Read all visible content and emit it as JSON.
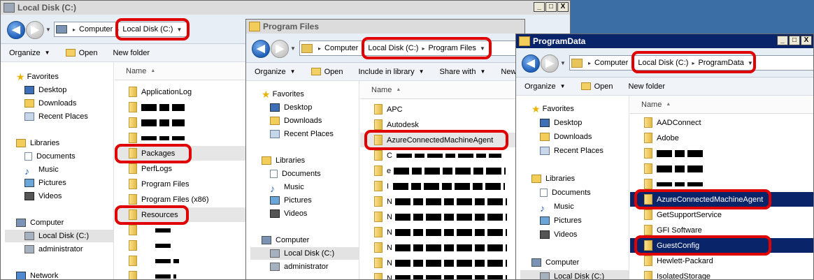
{
  "windows": [
    {
      "title": "Local Disk (C:)",
      "breadcrumbs": [
        "Computer",
        "Local Disk (C:)"
      ],
      "toolbar": [
        "Organize",
        "Open",
        "New folder"
      ],
      "column_header": "Name",
      "nav": [
        {
          "label": "Favorites"
        },
        {
          "label": "Desktop"
        },
        {
          "label": "Downloads"
        },
        {
          "label": "Recent Places"
        },
        {
          "label": "Libraries"
        },
        {
          "label": "Documents"
        },
        {
          "label": "Music"
        },
        {
          "label": "Pictures"
        },
        {
          "label": "Videos"
        },
        {
          "label": "Computer"
        },
        {
          "label": "Local Disk (C:)"
        },
        {
          "label": "administrator"
        },
        {
          "label": "Network"
        }
      ],
      "files": [
        {
          "label": "ApplicationLog"
        },
        {
          "label": ""
        },
        {
          "label": ""
        },
        {
          "label": ""
        },
        {
          "label": "Packages"
        },
        {
          "label": "PerfLogs"
        },
        {
          "label": "Program Files"
        },
        {
          "label": "Program Files (x86)"
        },
        {
          "label": "Resources"
        },
        {
          "label": ""
        },
        {
          "label": ""
        },
        {
          "label": ""
        },
        {
          "label": ""
        }
      ]
    },
    {
      "title": "Program Files",
      "breadcrumbs": [
        "Computer",
        "Local Disk (C:)",
        "Program Files"
      ],
      "toolbar": [
        "Organize",
        "Open",
        "Include in library",
        "Share with",
        "New"
      ],
      "column_header": "Name",
      "nav": [
        {
          "label": "Favorites"
        },
        {
          "label": "Desktop"
        },
        {
          "label": "Downloads"
        },
        {
          "label": "Recent Places"
        },
        {
          "label": "Libraries"
        },
        {
          "label": "Documents"
        },
        {
          "label": "Music"
        },
        {
          "label": "Pictures"
        },
        {
          "label": "Videos"
        },
        {
          "label": "Computer"
        },
        {
          "label": "Local Disk (C:)"
        },
        {
          "label": "administrator"
        }
      ],
      "files": [
        {
          "label": "APC"
        },
        {
          "label": "Autodesk"
        },
        {
          "label": "AzureConnectedMachineAgent"
        },
        {
          "label": "C"
        },
        {
          "label": "e"
        },
        {
          "label": "I"
        },
        {
          "label": "N"
        },
        {
          "label": "N"
        },
        {
          "label": "N"
        },
        {
          "label": "N"
        },
        {
          "label": "N"
        },
        {
          "label": "N"
        }
      ]
    },
    {
      "title": "ProgramData",
      "breadcrumbs": [
        "Computer",
        "Local Disk (C:)",
        "ProgramData"
      ],
      "toolbar": [
        "Organize",
        "Open",
        "New folder"
      ],
      "column_header": "Name",
      "nav": [
        {
          "label": "Favorites"
        },
        {
          "label": "Desktop"
        },
        {
          "label": "Downloads"
        },
        {
          "label": "Recent Places"
        },
        {
          "label": "Libraries"
        },
        {
          "label": "Documents"
        },
        {
          "label": "Music"
        },
        {
          "label": "Pictures"
        },
        {
          "label": "Videos"
        },
        {
          "label": "Computer"
        },
        {
          "label": "Local Disk (C:)"
        }
      ],
      "files": [
        {
          "label": "AADConnect"
        },
        {
          "label": "Adobe"
        },
        {
          "label": ""
        },
        {
          "label": ""
        },
        {
          "label": ""
        },
        {
          "label": "AzureConnectedMachineAgent"
        },
        {
          "label": "GetSupportService"
        },
        {
          "label": "GFI Software"
        },
        {
          "label": "GuestConfig"
        },
        {
          "label": "Hewlett-Packard"
        },
        {
          "label": "IsolatedStorage"
        }
      ]
    }
  ],
  "window_controls": {
    "minimize": "_",
    "maximize": "□",
    "close": "X"
  },
  "colors": {
    "highlight": "#e00000",
    "active_title": "#0a246a",
    "selected_row": "#0a246a"
  }
}
